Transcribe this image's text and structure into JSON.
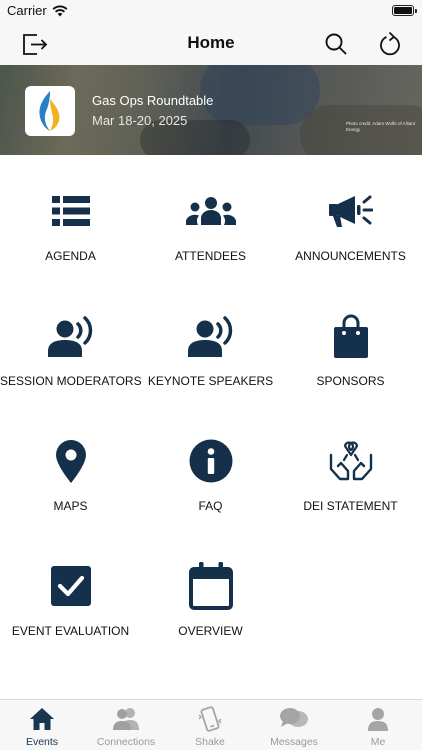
{
  "status_bar": {
    "carrier": "Carrier"
  },
  "header": {
    "title": "Home"
  },
  "event": {
    "name": "Gas Ops Roundtable",
    "dates": "Mar 18-20, 2025",
    "photo_credit": "Photo credit: Adam Wolfe of Alliant Energy"
  },
  "tiles": [
    {
      "label": "AGENDA",
      "icon": "list-icon"
    },
    {
      "label": "ATTENDEES",
      "icon": "users-icon"
    },
    {
      "label": "ANNOUNCEMENTS",
      "icon": "megaphone-icon"
    },
    {
      "label": "SESSION MODERATORS",
      "icon": "speaker-icon"
    },
    {
      "label": "KEYNOTE SPEAKERS",
      "icon": "speaker-icon"
    },
    {
      "label": "SPONSORS",
      "icon": "shopping-bag-icon"
    },
    {
      "label": "MAPS",
      "icon": "map-pin-icon"
    },
    {
      "label": "FAQ",
      "icon": "info-icon"
    },
    {
      "label": "DEI STATEMENT",
      "icon": "hands-ribbon-icon"
    },
    {
      "label": "EVENT EVALUATION",
      "icon": "checkbox-icon"
    },
    {
      "label": "OVERVIEW",
      "icon": "calendar-icon"
    }
  ],
  "tab_bar": [
    {
      "label": "Events",
      "icon": "home-icon",
      "active": true
    },
    {
      "label": "Connections",
      "icon": "people-icon",
      "active": false
    },
    {
      "label": "Shake",
      "icon": "shake-phone-icon",
      "active": false
    },
    {
      "label": "Messages",
      "icon": "chat-bubbles-icon",
      "active": false
    },
    {
      "label": "Me",
      "icon": "person-icon",
      "active": false
    }
  ],
  "colors": {
    "icon_navy": "#15304a",
    "tab_active": "#1a3550",
    "tab_inactive": "#a5a5a5",
    "bar_background": "#f7f7f7"
  }
}
